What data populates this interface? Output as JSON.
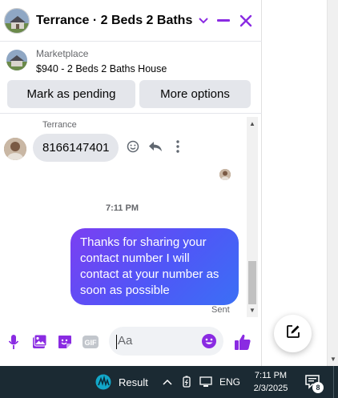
{
  "chat": {
    "title": "Terrance · 2 Beds 2 Baths ...",
    "listing": {
      "source": "Marketplace",
      "title": "$940 - 2 Beds 2 Baths House"
    },
    "buttons": {
      "mark_pending": "Mark as pending",
      "more_options": "More options"
    },
    "messages": {
      "sender_name": "Terrance",
      "incoming_text": "8166147401",
      "timestamp": "7:11 PM",
      "outgoing_text": "Thanks for sharing your contact number I will contact at your number as soon as possible",
      "status": "Sent"
    },
    "composer": {
      "placeholder": "Aa"
    }
  },
  "icons": {
    "header": [
      "chevron-down-icon",
      "minimize-icon",
      "close-icon"
    ],
    "message_actions": [
      "emoji-react-icon",
      "reply-icon",
      "more-vertical-icon"
    ],
    "composer": [
      "microphone-icon",
      "photo-icon",
      "sticker-icon",
      "gif-icon",
      "emoji-icon",
      "thumbs-up-icon"
    ],
    "new_message": "compose-icon"
  },
  "taskbar": {
    "weather_label": "Result",
    "language": "ENG",
    "time": "7:11 PM",
    "date": "2/3/2025",
    "notification_count": "8"
  },
  "colors": {
    "accent": "#8a2be2",
    "bubble_gradient_start": "#7b3ff2",
    "bubble_gradient_end": "#3b6ff5",
    "taskbar": "#1b2a33"
  }
}
